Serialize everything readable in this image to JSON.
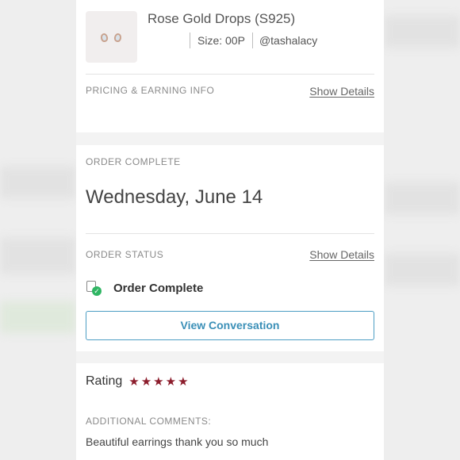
{
  "item": {
    "title": "Rose Gold Drops (S925)",
    "size": "Size: 00P",
    "seller": "@tashalacy"
  },
  "pricing": {
    "label": "PRICING & EARNING INFO",
    "details_link": "Show Details"
  },
  "order_complete": {
    "label": "ORDER COMPLETE",
    "date": "Wednesday, June 14"
  },
  "order_status": {
    "label": "ORDER STATUS",
    "details_link": "Show Details",
    "status": "Order Complete",
    "status_color": "#2fb563"
  },
  "conversation_button": "View Conversation",
  "rating": {
    "label": "Rating",
    "stars": 5,
    "star_glyph": "★",
    "star_color": "#8c1d2c"
  },
  "comments": {
    "label": "ADDITIONAL COMMENTS:",
    "text": "Beautiful earrings thank you so much"
  },
  "colors": {
    "link": "#3a8fb7",
    "text": "#333333"
  }
}
